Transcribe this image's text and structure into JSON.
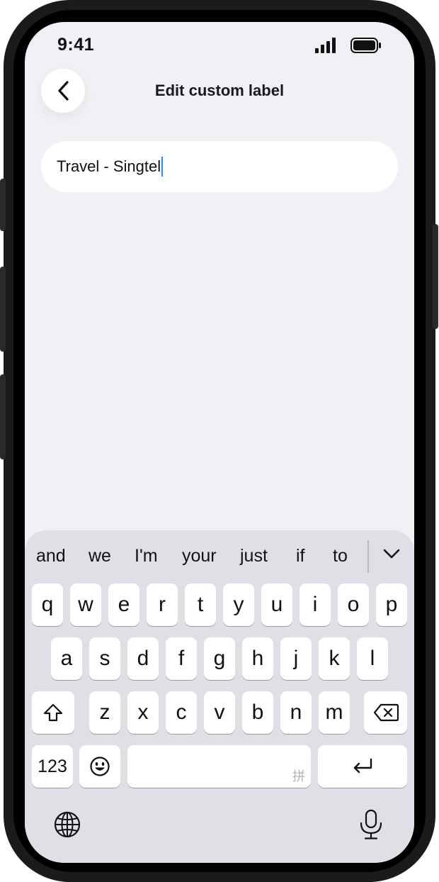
{
  "status_bar": {
    "time": "9:41"
  },
  "header": {
    "title": "Edit custom label"
  },
  "label_input": {
    "value": "Travel - Singtel"
  },
  "keyboard": {
    "suggestions": [
      "and",
      "we",
      "I'm",
      "your",
      "just",
      "if",
      "to"
    ],
    "row1": [
      "q",
      "w",
      "e",
      "r",
      "t",
      "y",
      "u",
      "i",
      "o",
      "p"
    ],
    "row2": [
      "a",
      "s",
      "d",
      "f",
      "g",
      "h",
      "j",
      "k",
      "l"
    ],
    "row3": [
      "z",
      "x",
      "c",
      "v",
      "b",
      "n",
      "m"
    ],
    "numbers_key": "123",
    "space_hint": "拼"
  },
  "icons": {
    "back": "chevron-left-icon",
    "signal": "cellular-signal-icon",
    "battery": "battery-icon",
    "collapse": "chevron-down-icon",
    "shift": "shift-icon",
    "delete": "delete-backspace-icon",
    "emoji": "emoji-icon",
    "return": "return-icon",
    "globe": "globe-icon",
    "mic": "microphone-icon"
  },
  "colors": {
    "caret": "#1f8cff",
    "screen_bg": "#f1f1f5",
    "keyboard_bg": "#dfe0e6"
  }
}
